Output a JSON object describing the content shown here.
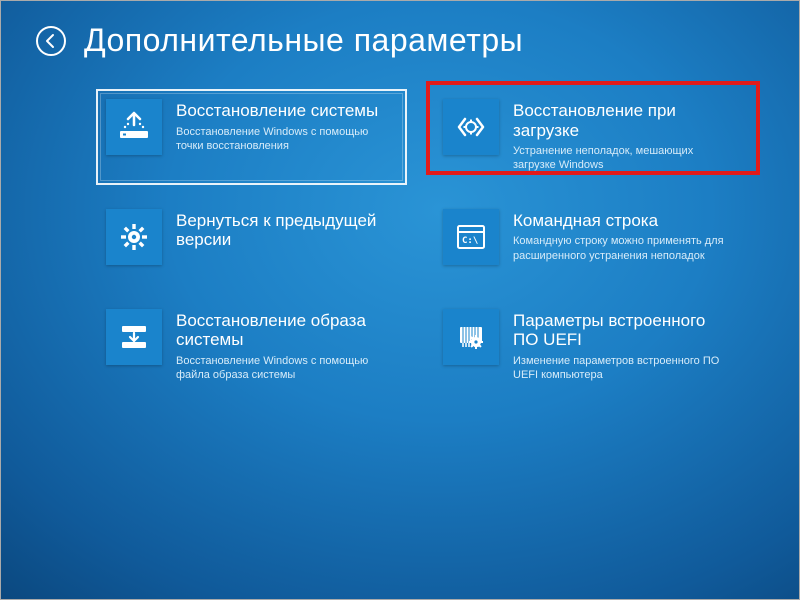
{
  "header": {
    "title": "Дополнительные параметры"
  },
  "tiles": {
    "system_restore": {
      "title": "Восстановление системы",
      "desc": "Восстановление Windows с помощью точки восстановления"
    },
    "startup_repair": {
      "title": "Восстановление при загрузке",
      "desc": "Устранение неполадок, мешающих загрузке Windows"
    },
    "go_back": {
      "title": "Вернуться к предыдущей версии",
      "desc": ""
    },
    "command_prompt": {
      "title": "Командная строка",
      "desc": "Командную строку можно применять для расширенного устранения неполадок"
    },
    "image_recovery": {
      "title": "Восстановление образа системы",
      "desc": "Восстановление Windows с помощью файла образа системы"
    },
    "uefi": {
      "title": "Параметры встроенного ПО UEFI",
      "desc": "Изменение параметров встроенного ПО UEFI компьютера"
    }
  },
  "colors": {
    "tile_icon_bg": "#1a84cc",
    "highlight_border": "#e11b1b"
  }
}
